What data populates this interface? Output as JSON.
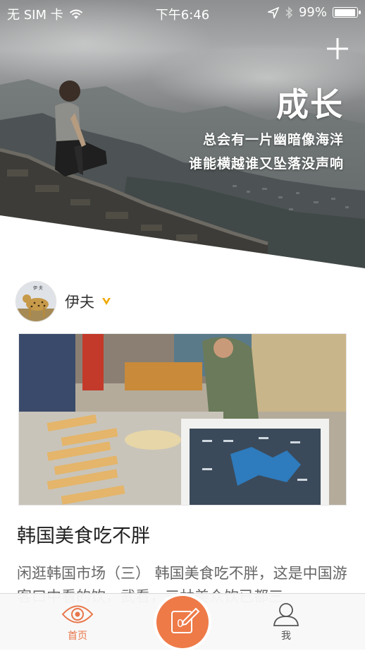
{
  "status_bar": {
    "carrier": "无 SIM 卡",
    "time": "下午6:46",
    "battery_text": "99%",
    "battery_level": 0.99
  },
  "hero": {
    "title": "成长",
    "line1": "总会有一片幽暗像海洋",
    "line2": "谁能横越谁又坠落没声响"
  },
  "author": {
    "name": "伊夫",
    "avatar_label": "伊 夫"
  },
  "post": {
    "title": "韩国美食吃不胖",
    "excerpt": "闲逛韩国市场（三） 韩国美食吃不胖，这是中国游客口中看的饮，武看，三林美众饮已都三"
  },
  "tabbar": {
    "home_label": "首页",
    "me_label": "我",
    "compose_count": "0"
  },
  "colors": {
    "accent": "#ee7a48",
    "vip": "#f0a800"
  }
}
